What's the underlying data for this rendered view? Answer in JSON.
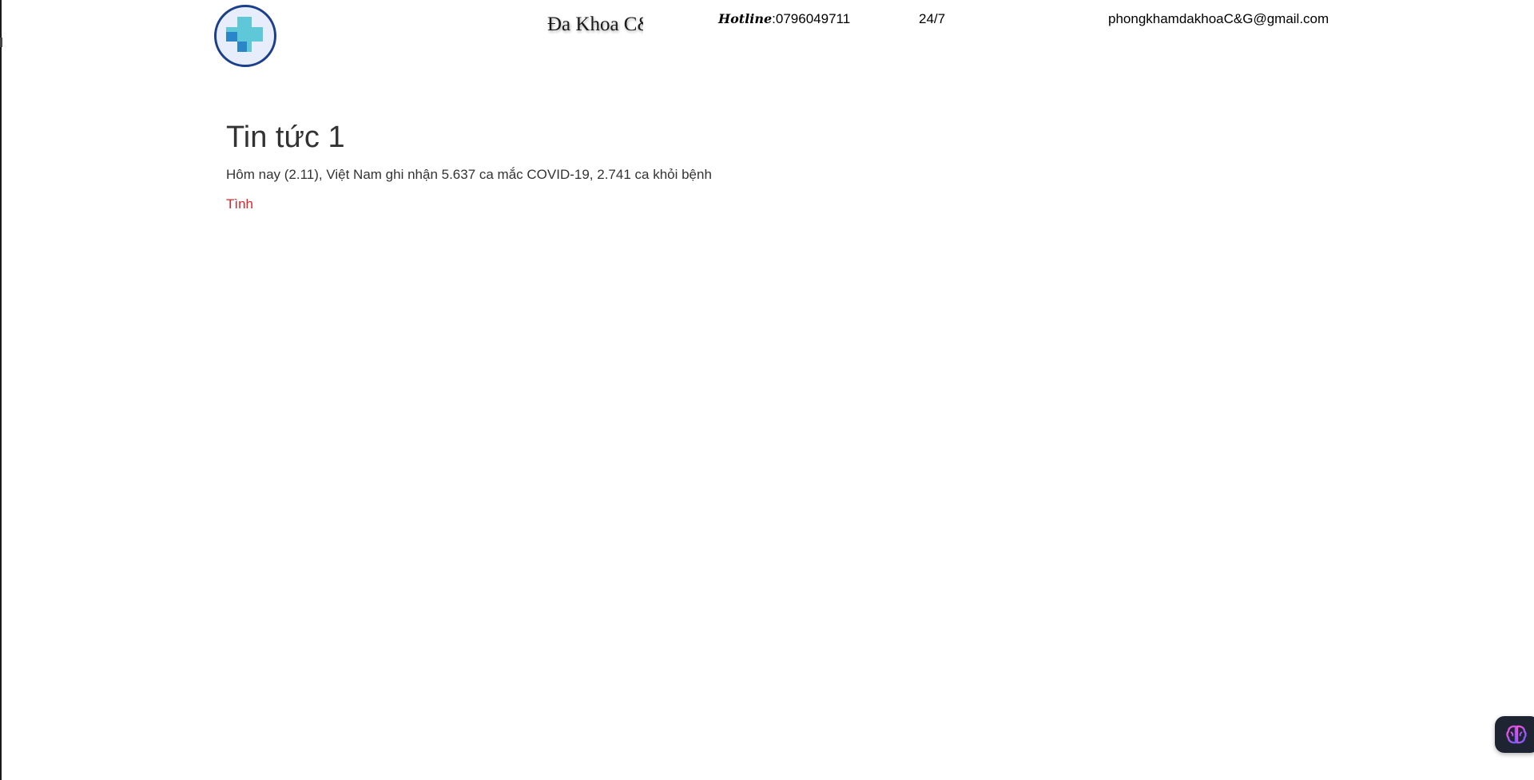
{
  "header": {
    "logo_icon": "medical-cross-icon",
    "clinic_name": "Đa Khoa C&G",
    "hotline_label": "Hotline",
    "hotline_number": "0796049711",
    "hours": "24/7",
    "email": "phongkhamdakhoaC&G@gmail.com"
  },
  "article": {
    "title": "Tin tức 1",
    "summary": "Hôm nay (2.11), Việt Nam ghi nhận 5.637 ca mắc COVID-19, 2.741 ca khỏi bệnh",
    "link_label": "Tình"
  },
  "widget": {
    "icon": "brain-icon"
  },
  "colors": {
    "logo_border": "#1b3f8b",
    "cross_light": "#5ec8d8",
    "cross_dark": "#2a86c9",
    "link": "#e0242b",
    "text": "#333333"
  }
}
